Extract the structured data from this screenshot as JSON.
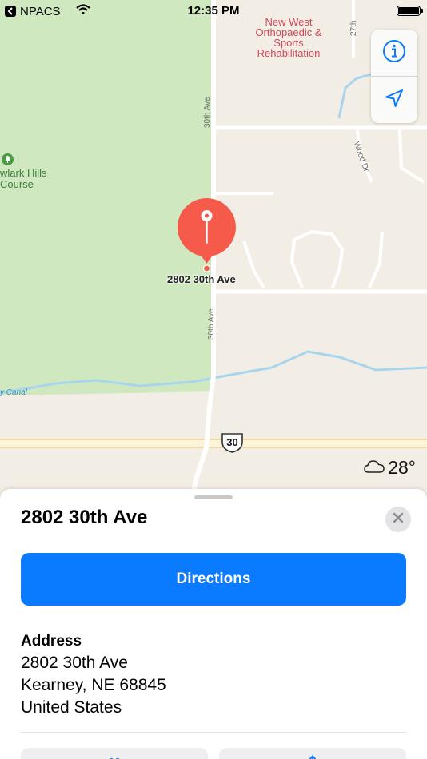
{
  "status_bar": {
    "carrier": "NPACS",
    "time": "12:35 PM",
    "battery_level": 1.0
  },
  "map": {
    "poi_label": "New West\nOrthopaedic &\nSports\nRehabilitation",
    "park_label": "wlark Hills\nCourse",
    "streets": {
      "thirtieth_top": "30th Ave",
      "thirtieth_bottom": "30th Ave",
      "twenty_seventh": "27th",
      "wood_dr": "Wood Dr"
    },
    "canal_label": "y Canal",
    "highway_shield": "30",
    "pin_label": "2802 30th Ave",
    "colors": {
      "land": "#f3eee5",
      "park": "#cfe8bf",
      "road": "#ffffff",
      "water": "#a7d5ee",
      "pin": "#f55a4a"
    }
  },
  "controls": {
    "info_icon": "info-icon",
    "location_icon": "location-arrow-icon"
  },
  "weather": {
    "icon": "cloud-icon",
    "temperature": "28°"
  },
  "sheet": {
    "title": "2802 30th Ave",
    "directions_label": "Directions",
    "address_heading": "Address",
    "address_lines": [
      "2802 30th Ave",
      "Kearney, NE  68845",
      "United States"
    ],
    "accent": "#0a7aff"
  }
}
